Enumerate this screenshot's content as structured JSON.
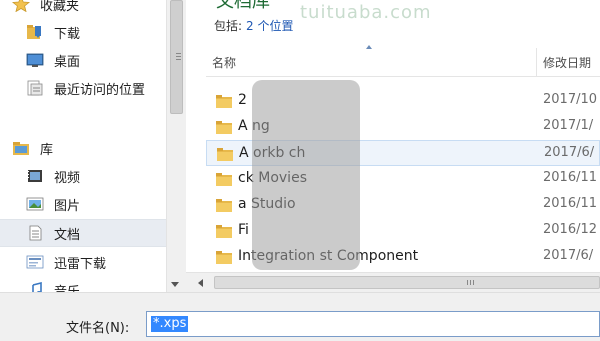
{
  "nav": {
    "items": [
      {
        "label": "收藏夹",
        "icon": "star-icon"
      },
      {
        "label": "下载",
        "icon": "download-folder-icon"
      },
      {
        "label": "桌面",
        "icon": "desktop-icon"
      },
      {
        "label": "最近访问的位置",
        "icon": "recent-places-icon"
      },
      {
        "label": "库",
        "icon": "library-icon"
      },
      {
        "label": "视频",
        "icon": "video-library-icon"
      },
      {
        "label": "图片",
        "icon": "pictures-library-icon"
      },
      {
        "label": "文档",
        "icon": "documents-library-icon"
      },
      {
        "label": "迅雷下载",
        "icon": "thunder-download-icon"
      },
      {
        "label": "音乐",
        "icon": "music-library-icon"
      }
    ]
  },
  "content": {
    "title": "文档库",
    "includes_label": "包括:",
    "includes_link": "2 个位置",
    "columns": {
      "name": "名称",
      "date": "修改日期"
    },
    "rows": [
      {
        "name": "2",
        "date": "2017/10"
      },
      {
        "name": "A            ng",
        "date": "2017/1/"
      },
      {
        "name": "A     orkb     ch",
        "date": "2017/6/"
      },
      {
        "name": "              ck Movies",
        "date": "2016/11"
      },
      {
        "name": "         a Studio",
        "date": "2016/11"
      },
      {
        "name": "Fi",
        "date": "2016/12"
      },
      {
        "name": "Integration              st Component",
        "date": "2017/6/"
      }
    ]
  },
  "bottom": {
    "filename_label": "文件名(N):",
    "filename_value": "*.xps"
  },
  "watermark": "tuituaba.com",
  "colors": {
    "accent": "#3388ff",
    "title_green": "#1e6a34",
    "link_blue": "#1e57b3",
    "folder": "#e7b84a"
  }
}
